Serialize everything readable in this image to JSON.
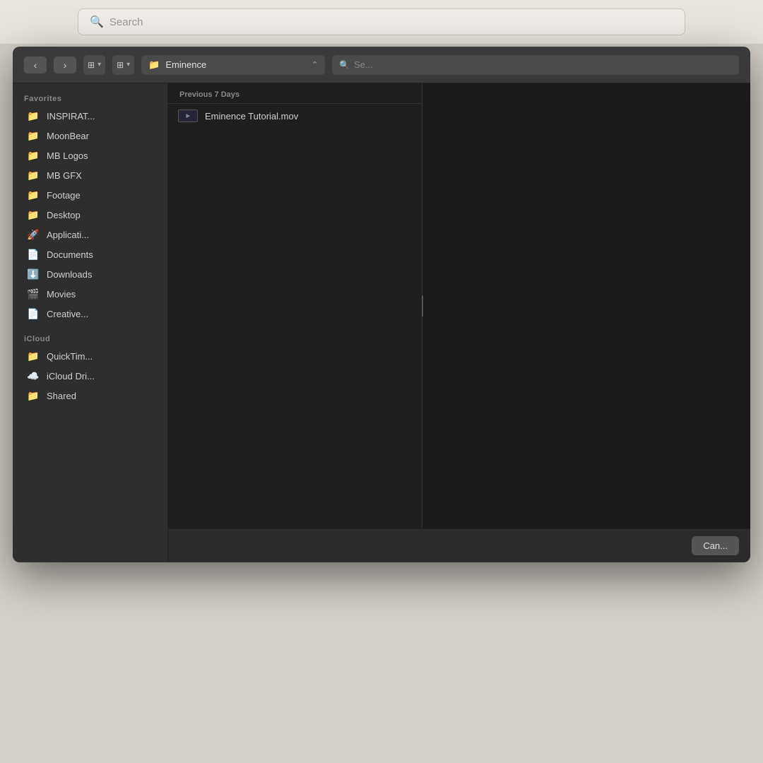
{
  "top_search": {
    "placeholder": "Search"
  },
  "toolbar": {
    "location": "Eminence",
    "search_placeholder": "Se..."
  },
  "sidebar": {
    "favorites_header": "Favorites",
    "icloud_header": "iCloud",
    "favorites_items": [
      {
        "id": "inspirat",
        "label": "INSPIRAT...",
        "icon": "📁"
      },
      {
        "id": "moonbear",
        "label": "MoonBear",
        "icon": "📁"
      },
      {
        "id": "mb-logos",
        "label": "MB Logos",
        "icon": "📁"
      },
      {
        "id": "mb-gfx",
        "label": "MB GFX",
        "icon": "📁"
      },
      {
        "id": "footage",
        "label": "Footage",
        "icon": "📁"
      },
      {
        "id": "desktop",
        "label": "Desktop",
        "icon": "📁"
      },
      {
        "id": "applications",
        "label": "Applicati...",
        "icon": "🚀"
      },
      {
        "id": "documents",
        "label": "Documents",
        "icon": "📄"
      },
      {
        "id": "downloads",
        "label": "Downloads",
        "icon": "⬇️"
      },
      {
        "id": "movies",
        "label": "Movies",
        "icon": "🎬"
      },
      {
        "id": "creative",
        "label": "Creative...",
        "icon": "📄"
      }
    ],
    "icloud_items": [
      {
        "id": "quicktime",
        "label": "QuickTim...",
        "icon": "📁"
      },
      {
        "id": "icloud-drive",
        "label": "iCloud Dri...",
        "icon": "☁️"
      },
      {
        "id": "shared",
        "label": "Shared",
        "icon": "📁"
      }
    ]
  },
  "file_list": {
    "date_section": "Previous 7 Days",
    "files": [
      {
        "id": "eminence-tutorial",
        "name": "Eminence Tutorial.mov",
        "icon_type": "mov"
      }
    ]
  },
  "bottom_bar": {
    "cancel_label": "Can..."
  }
}
